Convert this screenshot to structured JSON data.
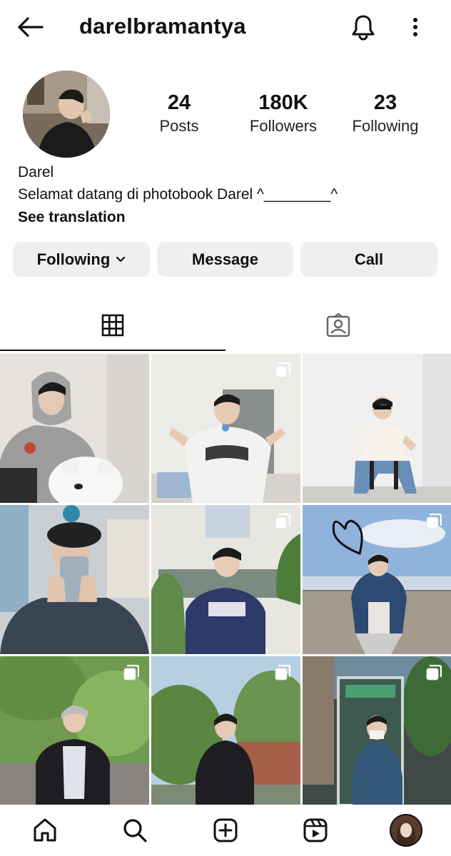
{
  "header": {
    "username": "darelbramantya",
    "icons": {
      "back": "arrow-left-icon",
      "bell": "bell-icon",
      "more": "more-vertical-icon"
    }
  },
  "profile": {
    "stats": [
      {
        "value": "24",
        "label": "Posts"
      },
      {
        "value": "180K",
        "label": "Followers"
      },
      {
        "value": "23",
        "label": "Following"
      }
    ],
    "name": "Darel",
    "bio": "Selamat datang di photobook Darel ^________^",
    "see_translation": "See translation"
  },
  "actions": {
    "following": "Following",
    "message": "Message",
    "call": "Call"
  },
  "tabs": [
    {
      "icon": "grid-icon",
      "active": true
    },
    {
      "icon": "tagged-icon",
      "active": false
    }
  ],
  "posts": [
    {
      "multi": false
    },
    {
      "multi": true
    },
    {
      "multi": false
    },
    {
      "multi": false
    },
    {
      "multi": true
    },
    {
      "multi": true
    },
    {
      "multi": true
    },
    {
      "multi": true
    },
    {
      "multi": true
    }
  ],
  "bottom_nav": [
    "home-icon",
    "search-icon",
    "create-icon",
    "reels-icon",
    "profile-avatar"
  ],
  "colors": {
    "text": "#111111",
    "button_bg": "#efefef",
    "background": "#ffffff"
  }
}
